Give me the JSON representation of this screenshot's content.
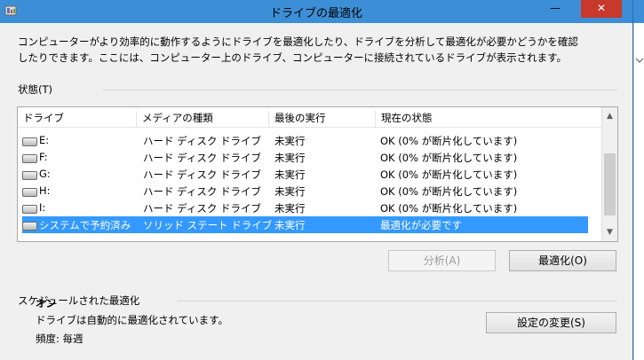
{
  "window": {
    "title": "ドライブの最適化",
    "minimize_glyph": "—",
    "close_glyph": "✕"
  },
  "description": "コンピューターがより効率的に動作するようにドライブを最適化したり、ドライブを分析して最適化が必要かどうかを確認したりできます。ここには、コンピューター上のドライブ、コンピューターに接続されているドライブが表示されます。",
  "status_group": {
    "label": "状態(T)",
    "columns": [
      "ドライブ",
      "メディアの種類",
      "最後の実行",
      "現在の状態"
    ],
    "rows": [
      {
        "drive": "E:",
        "media": "ハード ディスク ドライブ",
        "last_run": "未実行",
        "status": "OK (0% が断片化しています)",
        "selected": false
      },
      {
        "drive": "F:",
        "media": "ハード ディスク ドライブ",
        "last_run": "未実行",
        "status": "OK (0% が断片化しています)",
        "selected": false
      },
      {
        "drive": "G:",
        "media": "ハード ディスク ドライブ",
        "last_run": "未実行",
        "status": "OK (0% が断片化しています)",
        "selected": false
      },
      {
        "drive": "H:",
        "media": "ハード ディスク ドライブ",
        "last_run": "未実行",
        "status": "OK (0% が断片化しています)",
        "selected": false
      },
      {
        "drive": "I:",
        "media": "ハード ディスク ドライブ",
        "last_run": "未実行",
        "status": "OK (0% が断片化しています)",
        "selected": false
      },
      {
        "drive": "システムで予約済み",
        "media": "ソリッド ステート ドライブ",
        "last_run": "未実行",
        "status": "最適化が必要です",
        "selected": true
      }
    ],
    "scroll_up": "▲",
    "scroll_down": "▼"
  },
  "buttons": {
    "analyze": "分析(A)",
    "optimize": "最適化(O)",
    "change_settings": "設定の変更(S)"
  },
  "schedule": {
    "label": "スケジュールされた最適化",
    "state": "オン",
    "description": "ドライブは自動的に最適化されています。",
    "frequency": "頻度: 毎週"
  },
  "colors": {
    "titlebar": "#3c8fd6",
    "selection": "#3399ff",
    "close_button": "#c7392b"
  }
}
